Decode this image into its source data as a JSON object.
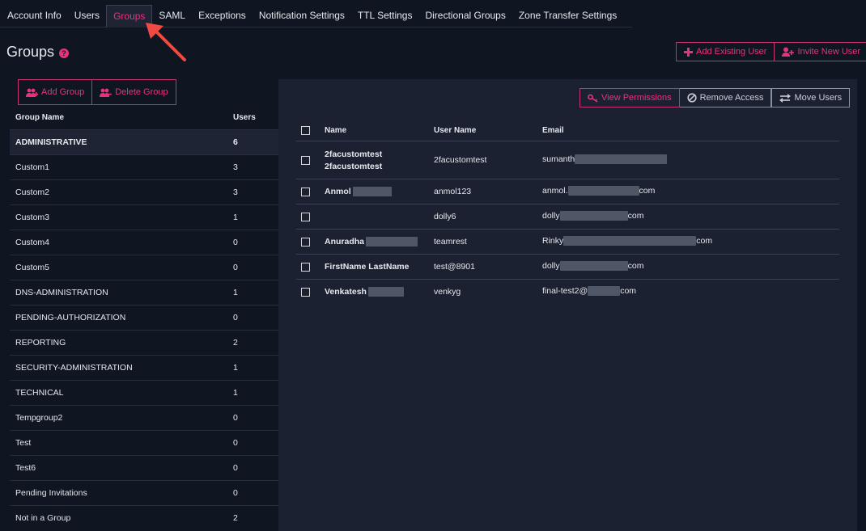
{
  "tabs": [
    {
      "label": "Account Info"
    },
    {
      "label": "Users"
    },
    {
      "label": "Groups",
      "active": true
    },
    {
      "label": "SAML"
    },
    {
      "label": "Exceptions"
    },
    {
      "label": "Notification Settings"
    },
    {
      "label": "TTL Settings"
    },
    {
      "label": "Directional Groups"
    },
    {
      "label": "Zone Transfer Settings"
    }
  ],
  "page": {
    "title": "Groups",
    "help_icon": "question-circle-icon"
  },
  "top_actions": {
    "add_existing_user": "Add Existing User",
    "invite_new_user": "Invite New User"
  },
  "group_actions": {
    "add_group": "Add Group",
    "delete_group": "Delete Group"
  },
  "groups_table": {
    "header_name": "Group Name",
    "header_users": "Users",
    "rows": [
      {
        "name": "ADMINISTRATIVE",
        "users": "6",
        "selected": true
      },
      {
        "name": "Custom1",
        "users": "3"
      },
      {
        "name": "Custom2",
        "users": "3"
      },
      {
        "name": "Custom3",
        "users": "1"
      },
      {
        "name": "Custom4",
        "users": "0"
      },
      {
        "name": "Custom5",
        "users": "0"
      },
      {
        "name": "DNS-ADMINISTRATION",
        "users": "1"
      },
      {
        "name": "PENDING-AUTHORIZATION",
        "users": "0"
      },
      {
        "name": "REPORTING",
        "users": "2"
      },
      {
        "name": "SECURITY-ADMINISTRATION",
        "users": "1"
      },
      {
        "name": "TECHNICAL",
        "users": "1"
      },
      {
        "name": "Tempgroup2",
        "users": "0"
      },
      {
        "name": "Test",
        "users": "0"
      },
      {
        "name": "Test6",
        "users": "0"
      },
      {
        "name": "Pending Invitations",
        "users": "0"
      },
      {
        "name": "Not in a Group",
        "users": "2"
      }
    ]
  },
  "user_actions": {
    "view_permissions": "View Permissions",
    "remove_access": "Remove Access",
    "move_users": "Move Users"
  },
  "users_table": {
    "header_name": "Name",
    "header_username": "User Name",
    "header_email": "Email",
    "rows": [
      {
        "name_line1": "2facustomtest",
        "name_line2": "2facustomtest",
        "username": "2facustomtest",
        "email_prefix": "sumanth",
        "email_suffix": ""
      },
      {
        "name_line1": "Anmol",
        "name_line2": "",
        "username": "anmol123",
        "email_prefix": "anmol.",
        "email_suffix": "com"
      },
      {
        "name_line1": "",
        "name_line2": "",
        "username": "dolly6",
        "email_prefix": "dolly",
        "email_suffix": "com"
      },
      {
        "name_line1": "Anuradha",
        "name_line2": "",
        "username": "teamrest",
        "email_prefix": "Rinky",
        "email_suffix": "com"
      },
      {
        "name_line1": "FirstName LastName",
        "name_line2": "",
        "username": "test@8901",
        "email_prefix": "dolly",
        "email_suffix": "com"
      },
      {
        "name_line1": "Venkatesh",
        "name_line2": "",
        "username": "venkyg",
        "email_prefix": "final-test2@",
        "email_suffix": "com"
      }
    ]
  },
  "colors": {
    "accent": "#e8337c",
    "background": "#0f1521",
    "panel": "#1b2130"
  }
}
